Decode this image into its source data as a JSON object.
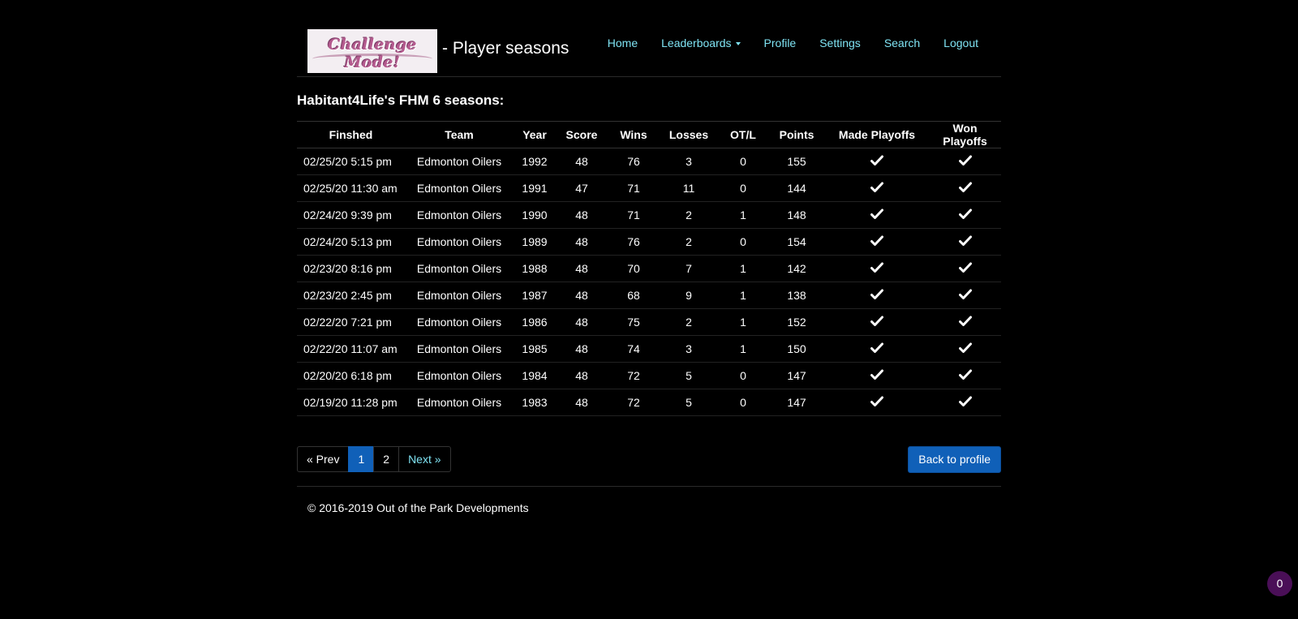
{
  "header": {
    "logo_text": "Challenge Mode!",
    "title": "- Player seasons",
    "nav": [
      {
        "label": "Home"
      },
      {
        "label": "Leaderboards",
        "dropdown": true
      },
      {
        "label": "Profile"
      },
      {
        "label": "Settings"
      },
      {
        "label": "Search"
      },
      {
        "label": "Logout"
      }
    ]
  },
  "heading": "Habitant4Life's FHM 6 seasons:",
  "table": {
    "columns": [
      "Finshed",
      "Team",
      "Year",
      "Score",
      "Wins",
      "Losses",
      "OT/L",
      "Points",
      "Made Playoffs",
      "Won Playoffs"
    ],
    "rows": [
      {
        "finished": "02/25/20 5:15 pm",
        "team": "Edmonton Oilers",
        "year": "1992",
        "score": "48",
        "wins": "76",
        "losses": "3",
        "otl": "0",
        "points": "155",
        "made_playoffs": true,
        "won_playoffs": true
      },
      {
        "finished": "02/25/20 11:30 am",
        "team": "Edmonton Oilers",
        "year": "1991",
        "score": "47",
        "wins": "71",
        "losses": "11",
        "otl": "0",
        "points": "144",
        "made_playoffs": true,
        "won_playoffs": true
      },
      {
        "finished": "02/24/20 9:39 pm",
        "team": "Edmonton Oilers",
        "year": "1990",
        "score": "48",
        "wins": "71",
        "losses": "2",
        "otl": "1",
        "points": "148",
        "made_playoffs": true,
        "won_playoffs": true
      },
      {
        "finished": "02/24/20 5:13 pm",
        "team": "Edmonton Oilers",
        "year": "1989",
        "score": "48",
        "wins": "76",
        "losses": "2",
        "otl": "0",
        "points": "154",
        "made_playoffs": true,
        "won_playoffs": true
      },
      {
        "finished": "02/23/20 8:16 pm",
        "team": "Edmonton Oilers",
        "year": "1988",
        "score": "48",
        "wins": "70",
        "losses": "7",
        "otl": "1",
        "points": "142",
        "made_playoffs": true,
        "won_playoffs": true
      },
      {
        "finished": "02/23/20 2:45 pm",
        "team": "Edmonton Oilers",
        "year": "1987",
        "score": "48",
        "wins": "68",
        "losses": "9",
        "otl": "1",
        "points": "138",
        "made_playoffs": true,
        "won_playoffs": true
      },
      {
        "finished": "02/22/20 7:21 pm",
        "team": "Edmonton Oilers",
        "year": "1986",
        "score": "48",
        "wins": "75",
        "losses": "2",
        "otl": "1",
        "points": "152",
        "made_playoffs": true,
        "won_playoffs": true
      },
      {
        "finished": "02/22/20 11:07 am",
        "team": "Edmonton Oilers",
        "year": "1985",
        "score": "48",
        "wins": "74",
        "losses": "3",
        "otl": "1",
        "points": "150",
        "made_playoffs": true,
        "won_playoffs": true
      },
      {
        "finished": "02/20/20 6:18 pm",
        "team": "Edmonton Oilers",
        "year": "1984",
        "score": "48",
        "wins": "72",
        "losses": "5",
        "otl": "0",
        "points": "147",
        "made_playoffs": true,
        "won_playoffs": true
      },
      {
        "finished": "02/19/20 11:28 pm",
        "team": "Edmonton Oilers",
        "year": "1983",
        "score": "48",
        "wins": "72",
        "losses": "5",
        "otl": "0",
        "points": "147",
        "made_playoffs": true,
        "won_playoffs": true
      }
    ],
    "check_icon": "check-icon"
  },
  "pagination": {
    "prev": "« Prev",
    "pages": [
      "1",
      "2"
    ],
    "current": "1",
    "next": "Next »"
  },
  "back_button": "Back to profile",
  "footer": "© 2016-2019 Out of the Park Developments",
  "badge_count": "0",
  "colors": {
    "background": "#000000",
    "link": "#7fe3f3",
    "primary": "#1060b8",
    "badge": "#4a0f57"
  }
}
